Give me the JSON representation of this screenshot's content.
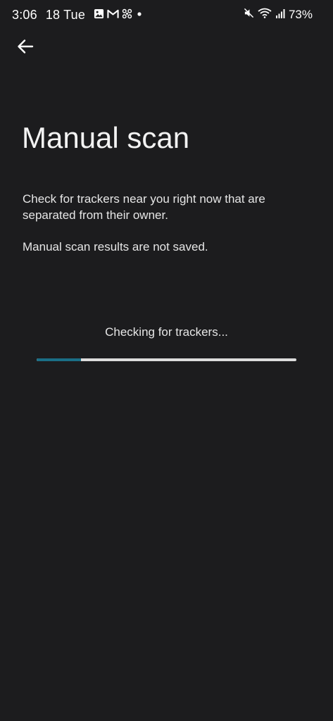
{
  "status_bar": {
    "time": "3:06",
    "date": "18 Tue",
    "notification_icons": [
      "gallery-icon",
      "gmail-icon",
      "pinwheel-icon",
      "dot-icon"
    ],
    "right_icons": [
      "mute-icon",
      "wifi-icon",
      "signal-icon"
    ],
    "battery": "73%"
  },
  "header": {
    "back_icon": "arrow-back-icon"
  },
  "main": {
    "title": "Manual scan",
    "description": "Check for trackers near you right now that are separated from their owner.",
    "note": "Manual scan results are not saved.",
    "status": "Checking for trackers...",
    "progress": 0.17
  },
  "colors": {
    "background": "#1c1c1e",
    "text": "#f1f1f1",
    "progress_fill": "#1a6e86",
    "progress_track": "#dcdcdc"
  }
}
